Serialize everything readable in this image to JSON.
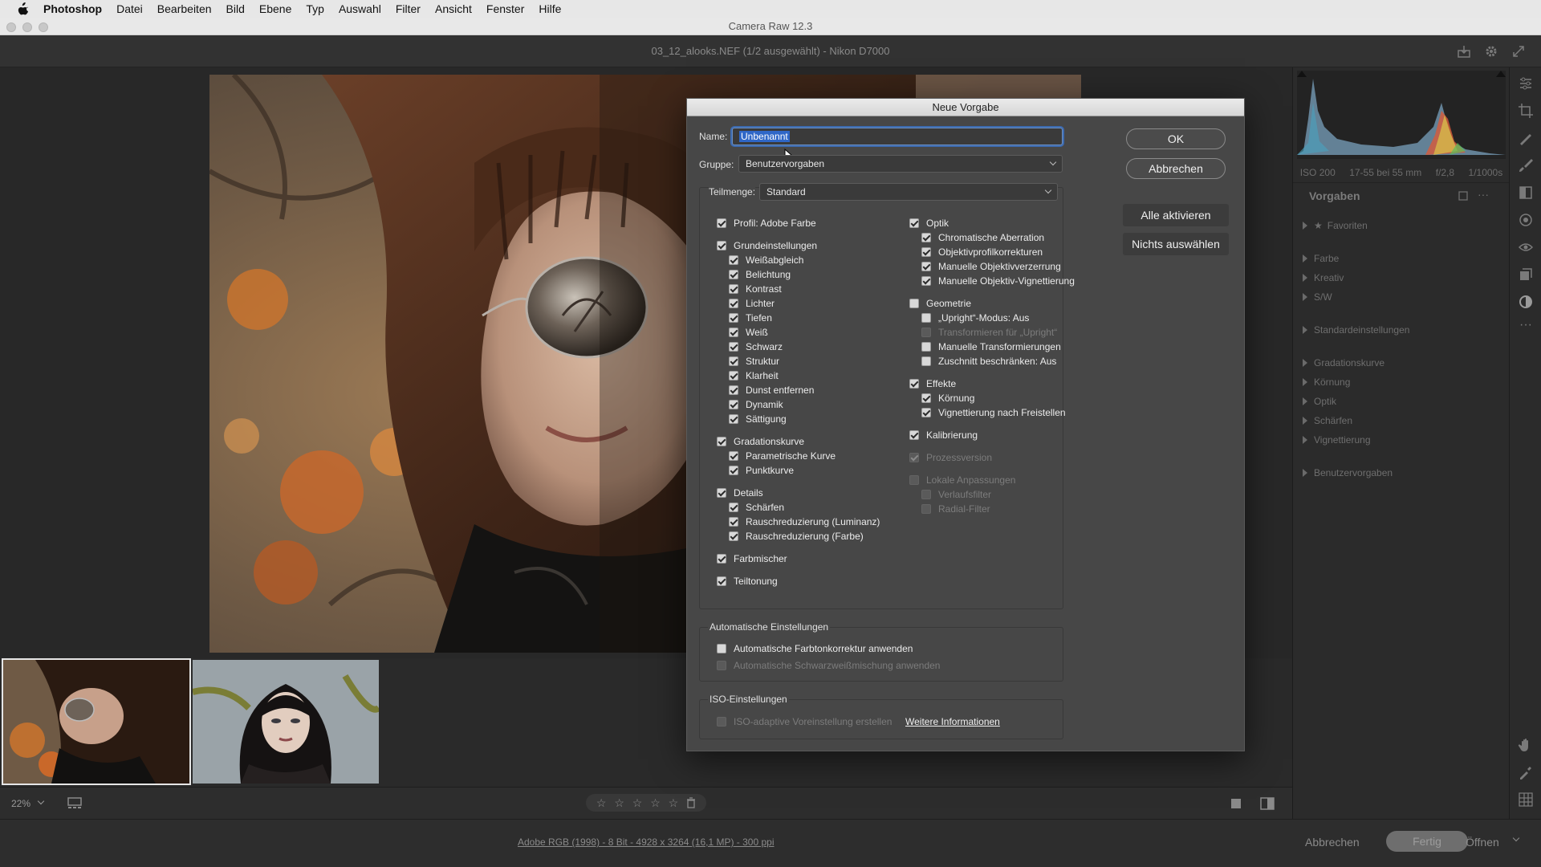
{
  "menubar": {
    "app": "Photoshop",
    "items": [
      "Datei",
      "Bearbeiten",
      "Bild",
      "Ebene",
      "Typ",
      "Auswahl",
      "Filter",
      "Ansicht",
      "Fenster",
      "Hilfe"
    ]
  },
  "window": {
    "title": "Camera Raw 12.3"
  },
  "file": {
    "header": "03_12_alooks.NEF (1/2 ausgewählt) - Nikon D7000"
  },
  "histogram": {
    "exif": [
      "ISO 200",
      "17-55 bei 55 mm",
      "f/2,8",
      "1/1000s"
    ]
  },
  "presets_panel": {
    "title": "Vorgaben",
    "items": [
      "Favoriten",
      "Farbe",
      "Kreativ",
      "S/W",
      "Standardeinstellungen",
      "Gradationskurve",
      "Körnung",
      "Optik",
      "Schärfen",
      "Vignettierung",
      "Benutzervorgaben"
    ]
  },
  "bottombar": {
    "zoom": "22%",
    "workflow": "Adobe RGB (1998) - 8 Bit - 4928 x 3264 (16,1 MP) - 300 ppi",
    "cancel": "Abbrechen",
    "done": "Fertig",
    "open": "Öffnen"
  },
  "dialog": {
    "title": "Neue Vorgabe",
    "name_label": "Name:",
    "name_value": "Unbenannt",
    "group_label": "Gruppe:",
    "group_value": "Benutzervorgaben",
    "subset_label": "Teilmenge:",
    "subset_value": "Standard",
    "ok": "OK",
    "cancel": "Abbrechen",
    "select_all": "Alle aktivieren",
    "select_none": "Nichts auswählen",
    "left_column": [
      {
        "label": "Profil: Adobe Farbe",
        "checked": true,
        "level": 0
      },
      {
        "label": "Grundeinstellungen",
        "checked": true,
        "level": 0
      },
      {
        "label": "Weißabgleich",
        "checked": true,
        "level": 1
      },
      {
        "label": "Belichtung",
        "checked": true,
        "level": 1
      },
      {
        "label": "Kontrast",
        "checked": true,
        "level": 1
      },
      {
        "label": "Lichter",
        "checked": true,
        "level": 1
      },
      {
        "label": "Tiefen",
        "checked": true,
        "level": 1
      },
      {
        "label": "Weiß",
        "checked": true,
        "level": 1
      },
      {
        "label": "Schwarz",
        "checked": true,
        "level": 1
      },
      {
        "label": "Struktur",
        "checked": true,
        "level": 1
      },
      {
        "label": "Klarheit",
        "checked": true,
        "level": 1
      },
      {
        "label": "Dunst entfernen",
        "checked": true,
        "level": 1
      },
      {
        "label": "Dynamik",
        "checked": true,
        "level": 1
      },
      {
        "label": "Sättigung",
        "checked": true,
        "level": 1
      },
      {
        "label": "Gradationskurve",
        "checked": true,
        "level": 0
      },
      {
        "label": "Parametrische Kurve",
        "checked": true,
        "level": 1
      },
      {
        "label": "Punktkurve",
        "checked": true,
        "level": 1
      },
      {
        "label": "Details",
        "checked": true,
        "level": 0
      },
      {
        "label": "Schärfen",
        "checked": true,
        "level": 1
      },
      {
        "label": "Rauschreduzierung (Luminanz)",
        "checked": true,
        "level": 1
      },
      {
        "label": "Rauschreduzierung (Farbe)",
        "checked": true,
        "level": 1
      },
      {
        "label": "Farbmischer",
        "checked": true,
        "level": 0
      },
      {
        "label": "Teiltonung",
        "checked": true,
        "level": 0
      }
    ],
    "right_column": [
      {
        "label": "Optik",
        "checked": true,
        "level": 0
      },
      {
        "label": "Chromatische Aberration",
        "checked": true,
        "level": 1
      },
      {
        "label": "Objektivprofilkorrekturen",
        "checked": true,
        "level": 1
      },
      {
        "label": "Manuelle Objektivverzerrung",
        "checked": true,
        "level": 1
      },
      {
        "label": "Manuelle Objektiv-Vignettierung",
        "checked": true,
        "level": 1
      },
      {
        "label": "Geometrie",
        "checked": false,
        "level": 0
      },
      {
        "label": "„Upright“-Modus: Aus",
        "checked": false,
        "level": 1
      },
      {
        "label": "Transformieren für „Upright“",
        "checked": false,
        "level": 1,
        "disabled": true
      },
      {
        "label": "Manuelle Transformierungen",
        "checked": false,
        "level": 1
      },
      {
        "label": "Zuschnitt beschränken: Aus",
        "checked": false,
        "level": 1
      },
      {
        "label": "Effekte",
        "checked": true,
        "level": 0
      },
      {
        "label": "Körnung",
        "checked": true,
        "level": 1
      },
      {
        "label": "Vignettierung nach Freistellen",
        "checked": true,
        "level": 1
      },
      {
        "label": "Kalibrierung",
        "checked": true,
        "level": 0
      },
      {
        "label": "Prozessversion",
        "checked": true,
        "level": 0,
        "disabled": true
      },
      {
        "label": "Lokale Anpassungen",
        "checked": false,
        "level": 0,
        "disabled": true
      },
      {
        "label": "Verlaufsfilter",
        "checked": false,
        "level": 1,
        "disabled": true
      },
      {
        "label": "Radial-Filter",
        "checked": false,
        "level": 1,
        "disabled": true
      }
    ],
    "auto_section": {
      "title": "Automatische Einstellungen",
      "items": [
        {
          "label": "Automatische Farbtonkorrektur anwenden",
          "checked": false
        },
        {
          "label": "Automatische Schwarzweißmischung anwenden",
          "checked": false,
          "disabled": true
        }
      ]
    },
    "iso_section": {
      "title": "ISO-Einstellungen",
      "item": {
        "label": "ISO-adaptive Voreinstellung erstellen",
        "checked": false,
        "disabled": true
      },
      "link": "Weitere Informationen"
    }
  }
}
